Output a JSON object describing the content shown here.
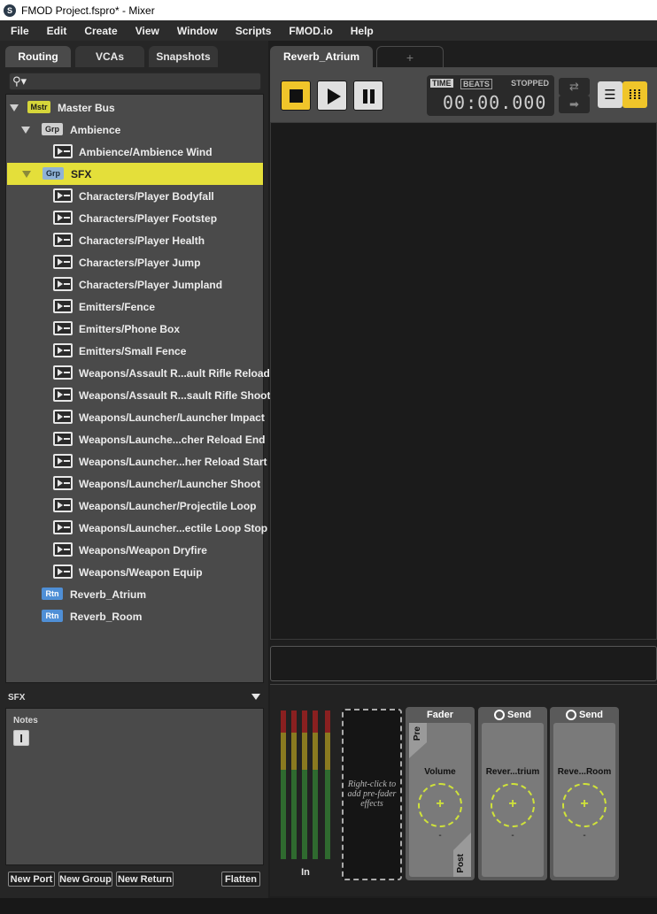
{
  "window": {
    "title": "FMOD Project.fspro* - Mixer",
    "app_icon": "fmod-logo-icon"
  },
  "menu": [
    "File",
    "Edit",
    "Create",
    "View",
    "Window",
    "Scripts",
    "FMOD.io",
    "Help"
  ],
  "left_tabs": [
    "Routing",
    "VCAs",
    "Snapshots"
  ],
  "tree": [
    {
      "label": "Master Bus",
      "badge": "Mstr",
      "type": "master"
    },
    {
      "label": "Ambience",
      "badge": "Grp",
      "type": "group"
    },
    {
      "label": "Ambience/Ambience Wind",
      "type": "event"
    },
    {
      "label": "SFX",
      "badge": "Grp",
      "type": "group",
      "selected": true
    },
    {
      "label": "Characters/Player Bodyfall",
      "type": "event"
    },
    {
      "label": "Characters/Player Footstep",
      "type": "event"
    },
    {
      "label": "Characters/Player Health",
      "type": "event"
    },
    {
      "label": "Characters/Player Jump",
      "type": "event"
    },
    {
      "label": "Characters/Player Jumpland",
      "type": "event"
    },
    {
      "label": "Emitters/Fence",
      "type": "event"
    },
    {
      "label": "Emitters/Phone Box",
      "type": "event"
    },
    {
      "label": "Emitters/Small Fence",
      "type": "event"
    },
    {
      "label": "Weapons/Assault R...ault Rifle Reload",
      "type": "event"
    },
    {
      "label": "Weapons/Assault R...sault Rifle Shoot",
      "type": "event"
    },
    {
      "label": "Weapons/Launcher/Launcher Impact",
      "type": "event"
    },
    {
      "label": "Weapons/Launche...cher Reload End",
      "type": "event"
    },
    {
      "label": "Weapons/Launcher...her Reload Start",
      "type": "event"
    },
    {
      "label": "Weapons/Launcher/Launcher Shoot",
      "type": "event"
    },
    {
      "label": "Weapons/Launcher/Projectile Loop",
      "type": "event"
    },
    {
      "label": "Weapons/Launcher...ectile Loop Stop",
      "type": "event"
    },
    {
      "label": "Weapons/Weapon Dryfire",
      "type": "event"
    },
    {
      "label": "Weapons/Weapon Equip",
      "type": "event"
    },
    {
      "label": "Reverb_Atrium",
      "badge": "Rtn",
      "type": "return"
    },
    {
      "label": "Reverb_Room",
      "badge": "Rtn",
      "type": "return"
    }
  ],
  "sfx_panel": {
    "header": "SFX",
    "notes_label": "Notes",
    "cursor_glyph": "I"
  },
  "bottom_buttons": [
    "New Port",
    "New Group",
    "New Return",
    "Flatten"
  ],
  "mixer": {
    "tab": "Reverb_Atrium",
    "add_tab": "+",
    "time_label": "TIME",
    "beats_label": "BEATS",
    "status": "STOPPED",
    "time": "00:00.000",
    "loop_glyph": "⇄",
    "forward_glyph": "➡",
    "list_glyph": "☰",
    "mix_glyph": "⁞⁞⁞"
  },
  "deck": {
    "in_label": "In",
    "prefader_hint": "Right-click to add pre-fader effects",
    "modules": [
      {
        "title": "Fader",
        "param": "Volume",
        "value": "-",
        "pre": "Pre",
        "post": "Post",
        "send_icon": false
      },
      {
        "title": "Send",
        "param": "Rever...trium",
        "value": "-",
        "send_icon": true
      },
      {
        "title": "Send",
        "param": "Reve...Room",
        "value": "-",
        "send_icon": true
      }
    ]
  },
  "colors": {
    "accent_yellow": "#e4df3a",
    "transport_yellow": "#f0c52a",
    "knob_green": "#cfe23a",
    "return_blue": "#4f8fd6"
  }
}
